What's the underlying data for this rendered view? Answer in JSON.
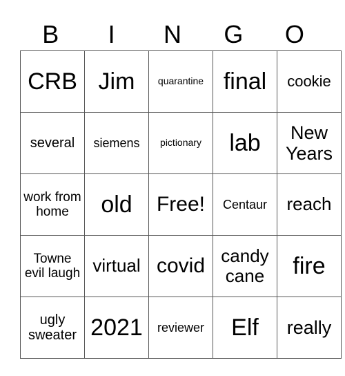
{
  "header": [
    "B",
    "I",
    "N",
    "G",
    "O"
  ],
  "rows": [
    [
      "CRB",
      "Jim",
      "quarantine",
      "final",
      "cookie"
    ],
    [
      "several",
      "siemens",
      "pictionary",
      "lab",
      "New Years"
    ],
    [
      "work from home",
      "old",
      "Free!",
      "Centaur",
      "reach"
    ],
    [
      "Towne evil laugh",
      "virtual",
      "covid",
      "candy cane",
      "fire"
    ],
    [
      "ugly sweater",
      "2021",
      "reviewer",
      "Elf",
      "really"
    ]
  ]
}
